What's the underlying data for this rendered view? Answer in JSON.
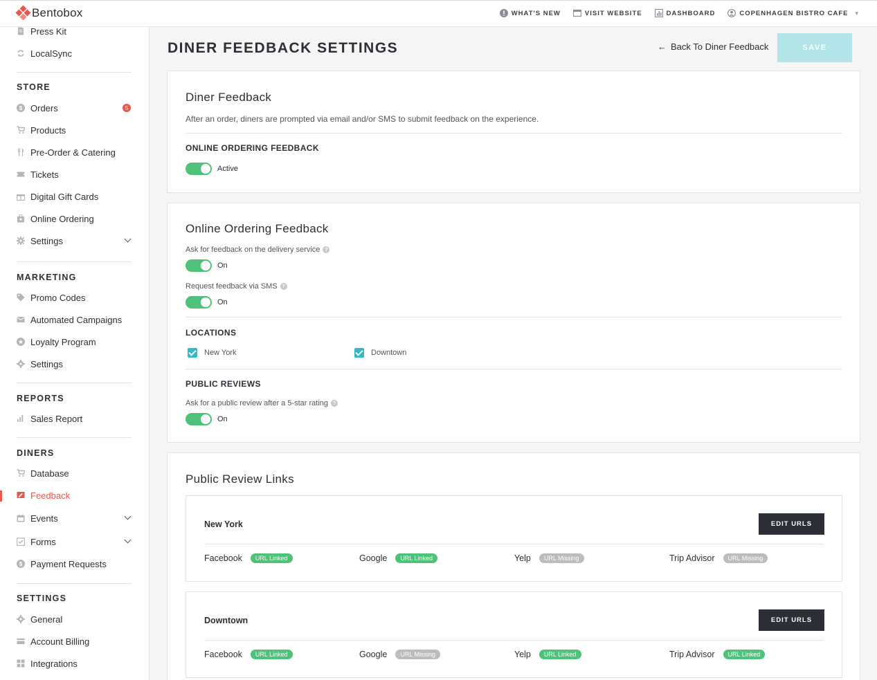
{
  "brand": {
    "name": "Bentobox",
    "accent": "#e8574a",
    "toggle_color": "#4fc27a",
    "check_color": "#35b9c7"
  },
  "topnav": [
    {
      "label": "What's New",
      "icon": "info-icon"
    },
    {
      "label": "Visit Website",
      "icon": "browser-icon"
    },
    {
      "label": "Dashboard",
      "icon": "chart-icon"
    },
    {
      "label": "Copenhagen Bistro Cafe",
      "icon": "user-icon"
    }
  ],
  "sidebar": {
    "top_items": [
      {
        "label": "Press Kit",
        "icon": "document-icon"
      },
      {
        "label": "LocalSync",
        "icon": "sync-icon"
      }
    ],
    "sections": [
      {
        "title": "STORE",
        "items": [
          {
            "label": "Orders",
            "icon": "dollar-icon",
            "badge": "5"
          },
          {
            "label": "Products",
            "icon": "cart-icon"
          },
          {
            "label": "Pre-Order & Catering",
            "icon": "utensils-icon"
          },
          {
            "label": "Tickets",
            "icon": "ticket-icon"
          },
          {
            "label": "Digital Gift Cards",
            "icon": "gift-icon"
          },
          {
            "label": "Online Ordering",
            "icon": "bag-icon"
          },
          {
            "label": "Settings",
            "icon": "gear-icon"
          }
        ]
      },
      {
        "title": "MARKETING",
        "items": [
          {
            "label": "Promo Codes",
            "icon": "tag-icon"
          },
          {
            "label": "Automated Campaigns",
            "icon": "mail-icon"
          },
          {
            "label": "Loyalty Program",
            "icon": "star-icon"
          },
          {
            "label": "Settings",
            "icon": "gear-icon"
          }
        ]
      },
      {
        "title": "REPORTS",
        "items": [
          {
            "label": "Sales Report",
            "icon": "bar-chart-icon"
          }
        ]
      },
      {
        "title": "DINERS",
        "items": [
          {
            "label": "Database",
            "icon": "cart-icon"
          },
          {
            "label": "Feedback",
            "icon": "feedback-icon"
          },
          {
            "label": "Events",
            "icon": "calendar-icon"
          },
          {
            "label": "Forms",
            "icon": "form-icon"
          },
          {
            "label": "Payment Requests",
            "icon": "dollar-icon"
          }
        ]
      },
      {
        "title": "SETTINGS",
        "items": [
          {
            "label": "General",
            "icon": "gear-icon"
          },
          {
            "label": "Account Billing",
            "icon": "card-icon"
          },
          {
            "label": "Integrations",
            "icon": "grid-icon"
          }
        ]
      }
    ]
  },
  "header": {
    "title": "DINER FEEDBACK SETTINGS",
    "back_label": "Back To Diner Feedback",
    "save_label": "SAVE"
  },
  "diner_feedback": {
    "title": "Diner Feedback",
    "description": "After an order, diners are prompted via email and/or SMS to submit feedback on the experience.",
    "subhead": "ONLINE ORDERING FEEDBACK",
    "toggle_label": "Active"
  },
  "online_feedback": {
    "title": "Online Ordering Feedback",
    "delivery_label": "Ask for feedback on the delivery service",
    "delivery_state": "On",
    "sms_label": "Request feedback via SMS",
    "sms_state": "On",
    "locations_head": "LOCATIONS",
    "locations": [
      "New York",
      "Downtown"
    ],
    "reviews_head": "PUBLIC REVIEWS",
    "review_label": "Ask for a public review after a 5-star rating",
    "review_state": "On"
  },
  "review_links": {
    "title": "Public Review Links",
    "edit_label": "EDIT URLS",
    "locations": [
      {
        "name": "New York",
        "links": [
          {
            "site": "Facebook",
            "status": "URL Linked"
          },
          {
            "site": "Google",
            "status": "URL Linked"
          },
          {
            "site": "Yelp",
            "status": "URL Missing"
          },
          {
            "site": "Trip Advisor",
            "status": "URL Missing"
          }
        ]
      },
      {
        "name": "Downtown",
        "links": [
          {
            "site": "Facebook",
            "status": "URL Linked"
          },
          {
            "site": "Google",
            "status": "URL Missing"
          },
          {
            "site": "Yelp",
            "status": "URL Linked"
          },
          {
            "site": "Trip Advisor",
            "status": "URL Linked"
          }
        ]
      }
    ]
  }
}
